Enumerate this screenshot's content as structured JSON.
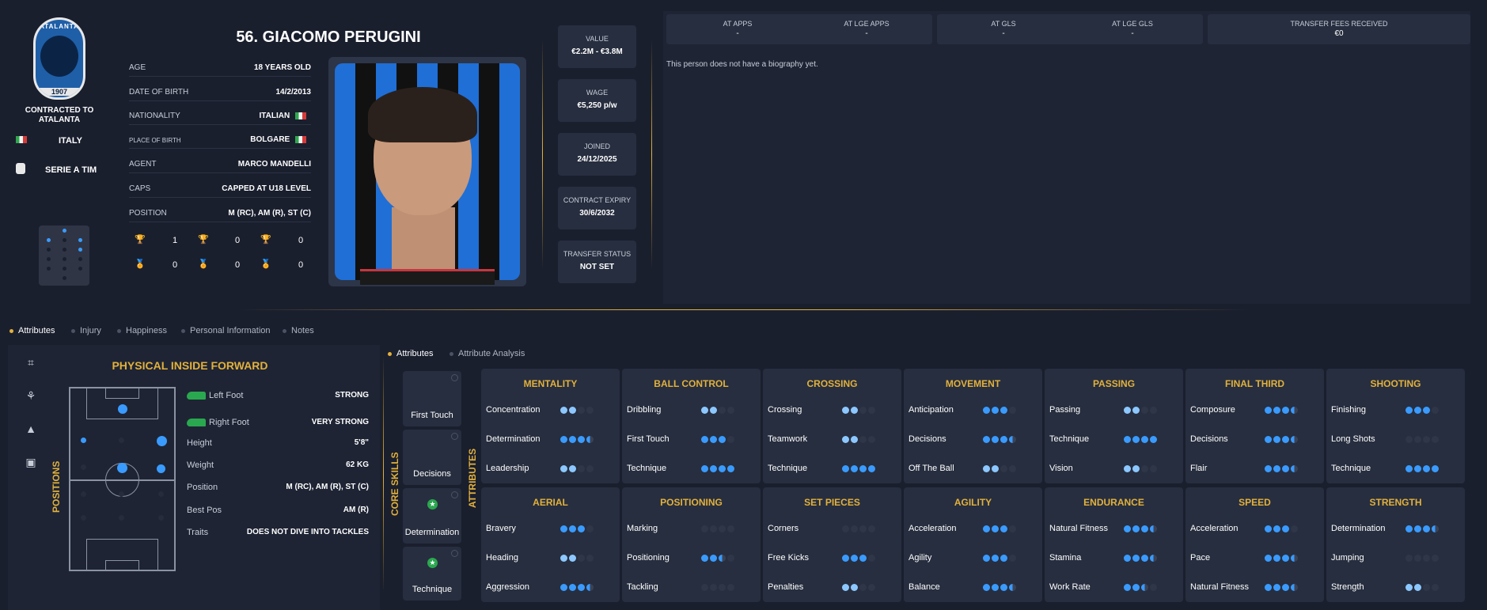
{
  "club": {
    "name_line1": "CONTRACTED TO",
    "name_line2": "ATALANTA",
    "crest_text": "ATALANTA",
    "crest_year": "1907"
  },
  "nation": "ITALY",
  "league": "SERIE A TIM",
  "player": {
    "title": "56. GIACOMO PERUGINI"
  },
  "info": [
    {
      "key": "AGE",
      "val": "18 YEARS OLD"
    },
    {
      "key": "DATE OF BIRTH",
      "val": "14/2/2013"
    },
    {
      "key": "NATIONALITY",
      "val": "ITALIAN"
    },
    {
      "key": "PLACE OF BIRTH",
      "val": "BOLGARE"
    },
    {
      "key": "AGENT",
      "val": "MARCO MANDELLI"
    },
    {
      "key": "CAPS",
      "val": "CAPPED AT U18 LEVEL"
    },
    {
      "key": "POSITION",
      "val": "M (RC), AM (R), ST (C)"
    }
  ],
  "trophies": {
    "row1": [
      "1",
      "0",
      "0"
    ],
    "row2": [
      "0",
      "0",
      "0"
    ]
  },
  "stats": [
    {
      "k": "VALUE",
      "v": "€2.2M - €3.8M"
    },
    {
      "k": "WAGE",
      "v": "€5,250 p/w"
    },
    {
      "k": "JOINED",
      "v": "24/12/2025"
    },
    {
      "k": "CONTRACT EXPIRY",
      "v": "30/6/2032"
    },
    {
      "k": "TRANSFER STATUS",
      "v": "NOT SET"
    }
  ],
  "career": [
    {
      "k": "AT APPS",
      "v": "-"
    },
    {
      "k": "AT LGE APPS",
      "v": "-"
    },
    {
      "k": "AT GLS",
      "v": "-"
    },
    {
      "k": "AT LGE GLS",
      "v": "-"
    },
    {
      "k": "TRANSFER FEES RECEIVED",
      "v": "€0"
    }
  ],
  "bio": "This person does not have a biography yet.",
  "tabs": [
    "Attributes",
    "Injury",
    "Happiness",
    "Personal Information",
    "Notes"
  ],
  "role": "PHYSICAL INSIDE FORWARD",
  "positions_label": "POSITIONS",
  "physical": [
    {
      "k": "Left Foot",
      "v": "STRONG"
    },
    {
      "k": "Right Foot",
      "v": "VERY STRONG"
    },
    {
      "k": "Height",
      "v": "5'8\""
    },
    {
      "k": "Weight",
      "v": "62 KG"
    },
    {
      "k": "Position",
      "v": "M (RC), AM (R), ST (C)"
    },
    {
      "k": "Best Pos",
      "v": "AM (R)"
    },
    {
      "k": "Traits",
      "v": "DOES NOT DIVE INTO TACKLES"
    }
  ],
  "subtabs": [
    "Attributes",
    "Attribute Analysis"
  ],
  "core_label": "CORE SKILLS",
  "attr_label": "ATTRIBUTES",
  "core_skills": [
    "First Touch",
    "Decisions",
    "Determination",
    "Technique"
  ],
  "groups_top": [
    {
      "t": "MENTALITY",
      "a": [
        [
          "Concentration",
          2
        ],
        [
          "Determination",
          3.5
        ],
        [
          "Leadership",
          2
        ]
      ]
    },
    {
      "t": "BALL CONTROL",
      "a": [
        [
          "Dribbling",
          2
        ],
        [
          "First Touch",
          3
        ],
        [
          "Technique",
          4
        ]
      ]
    },
    {
      "t": "CROSSING",
      "a": [
        [
          "Crossing",
          2
        ],
        [
          "Teamwork",
          2
        ],
        [
          "Technique",
          4
        ]
      ]
    },
    {
      "t": "MOVEMENT",
      "a": [
        [
          "Anticipation",
          3
        ],
        [
          "Decisions",
          3.5
        ],
        [
          "Off The Ball",
          2
        ]
      ]
    },
    {
      "t": "PASSING",
      "a": [
        [
          "Passing",
          2
        ],
        [
          "Technique",
          4
        ],
        [
          "Vision",
          2
        ]
      ]
    },
    {
      "t": "FINAL THIRD",
      "a": [
        [
          "Composure",
          3.5
        ],
        [
          "Decisions",
          3.5
        ],
        [
          "Flair",
          3.5
        ]
      ]
    },
    {
      "t": "SHOOTING",
      "a": [
        [
          "Finishing",
          3
        ],
        [
          "Long Shots",
          0
        ],
        [
          "Technique",
          4
        ]
      ]
    }
  ],
  "groups_bottom": [
    {
      "t": "AERIAL",
      "a": [
        [
          "Bravery",
          3
        ],
        [
          "Heading",
          2
        ],
        [
          "Aggression",
          3.5
        ]
      ]
    },
    {
      "t": "POSITIONING",
      "a": [
        [
          "Marking",
          0
        ],
        [
          "Positioning",
          2.5
        ],
        [
          "Tackling",
          0
        ]
      ]
    },
    {
      "t": "SET PIECES",
      "a": [
        [
          "Corners",
          0
        ],
        [
          "Free Kicks",
          3
        ],
        [
          "Penalties",
          2
        ]
      ]
    },
    {
      "t": "AGILITY",
      "a": [
        [
          "Acceleration",
          3
        ],
        [
          "Agility",
          3
        ],
        [
          "Balance",
          3.5
        ]
      ]
    },
    {
      "t": "ENDURANCE",
      "a": [
        [
          "Natural Fitness",
          3.5
        ],
        [
          "Stamina",
          3.5
        ],
        [
          "Work Rate",
          2.5
        ]
      ]
    },
    {
      "t": "SPEED",
      "a": [
        [
          "Acceleration",
          3
        ],
        [
          "Pace",
          3.5
        ],
        [
          "Natural Fitness",
          3.5
        ]
      ]
    },
    {
      "t": "STRENGTH",
      "a": [
        [
          "Determination",
          3.5
        ],
        [
          "Jumping",
          0
        ],
        [
          "Strength",
          2
        ]
      ]
    }
  ],
  "colors": {
    "accent": "#e2b13c",
    "dot": "#3a9bff",
    "dot_light": "#8cc8ff"
  }
}
